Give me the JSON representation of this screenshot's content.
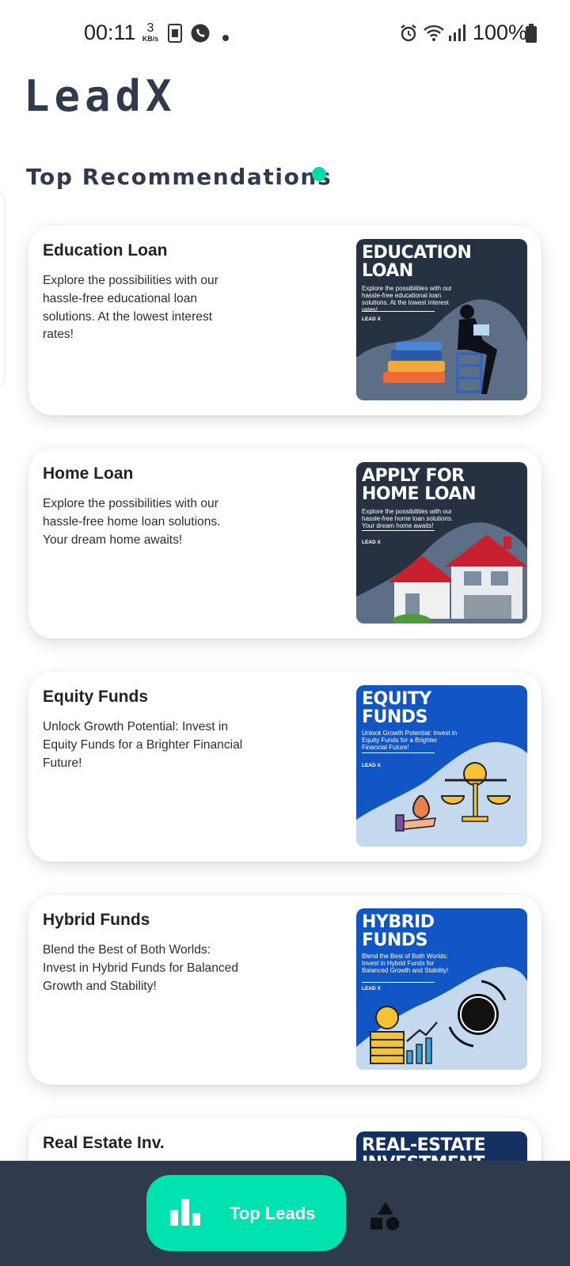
{
  "status_bar": {
    "time": "00:11",
    "net_speed_value": "3",
    "net_speed_unit": "KB/s",
    "battery": "100%",
    "icons": [
      "sim-card-icon",
      "whatsapp-icon",
      "notification-dot-icon",
      "alarm-icon",
      "wifi-icon",
      "signal-icon",
      "battery-icon"
    ]
  },
  "header": {
    "app_title": "LeadX",
    "section_title": "Top Recommendations"
  },
  "cards": [
    {
      "title": "Education Loan",
      "description": "Explore the possibilities with our hassle-free educational loan solutions. At the lowest interest rates!",
      "thumb_heading": "EDUCATION LOAN",
      "thumb_text": "Explore the possibilities with our hassle-free educational loan solutions. At the lowest interest rates!",
      "thumb_brand": "LEAD X",
      "thumb_bg": "#263241"
    },
    {
      "title": "Home Loan",
      "description": "Explore the possibilities with our hassle-free home loan solutions. Your dream home awaits!",
      "thumb_heading": "APPLY FOR HOME LOAN",
      "thumb_text": "Explore the possibilities with our hassle-free home loan solutions. Your dream home awaits!",
      "thumb_brand": "LEAD X",
      "thumb_bg": "#263241"
    },
    {
      "title": "Equity Funds",
      "description": "Unlock Growth Potential: Invest in Equity Funds for a Brighter Financial Future!",
      "thumb_heading": "EQUITY FUNDS",
      "thumb_text": "Unlock Growth Potential: Invest in Equity Funds for a Brighter Financial Future!",
      "thumb_brand": "LEAD X",
      "thumb_bg": "#1255c4"
    },
    {
      "title": "Hybrid Funds",
      "description": "Blend the Best of Both Worlds: Invest in Hybrid Funds for Balanced Growth and Stability!",
      "thumb_heading": "HYBRID FUNDS",
      "thumb_text": "Blend the Best of Both Worlds: Invest in Hybrid Funds for Balanced Growth and Stability!",
      "thumb_brand": "LEAD X",
      "thumb_bg": "#1255c4"
    },
    {
      "title": "Real Estate Inv.",
      "thumb_heading": "REAL-ESTATE INVESTMENT",
      "thumb_bg": "#14305e"
    }
  ],
  "bottom_nav": {
    "active_label": "Top Leads",
    "active_icon": "bar-chart-icon",
    "other_icon": "shapes-icon"
  },
  "colors": {
    "accent": "#00e3b0",
    "dark": "#2f3b4c",
    "live_dot": "#00d9a8"
  }
}
